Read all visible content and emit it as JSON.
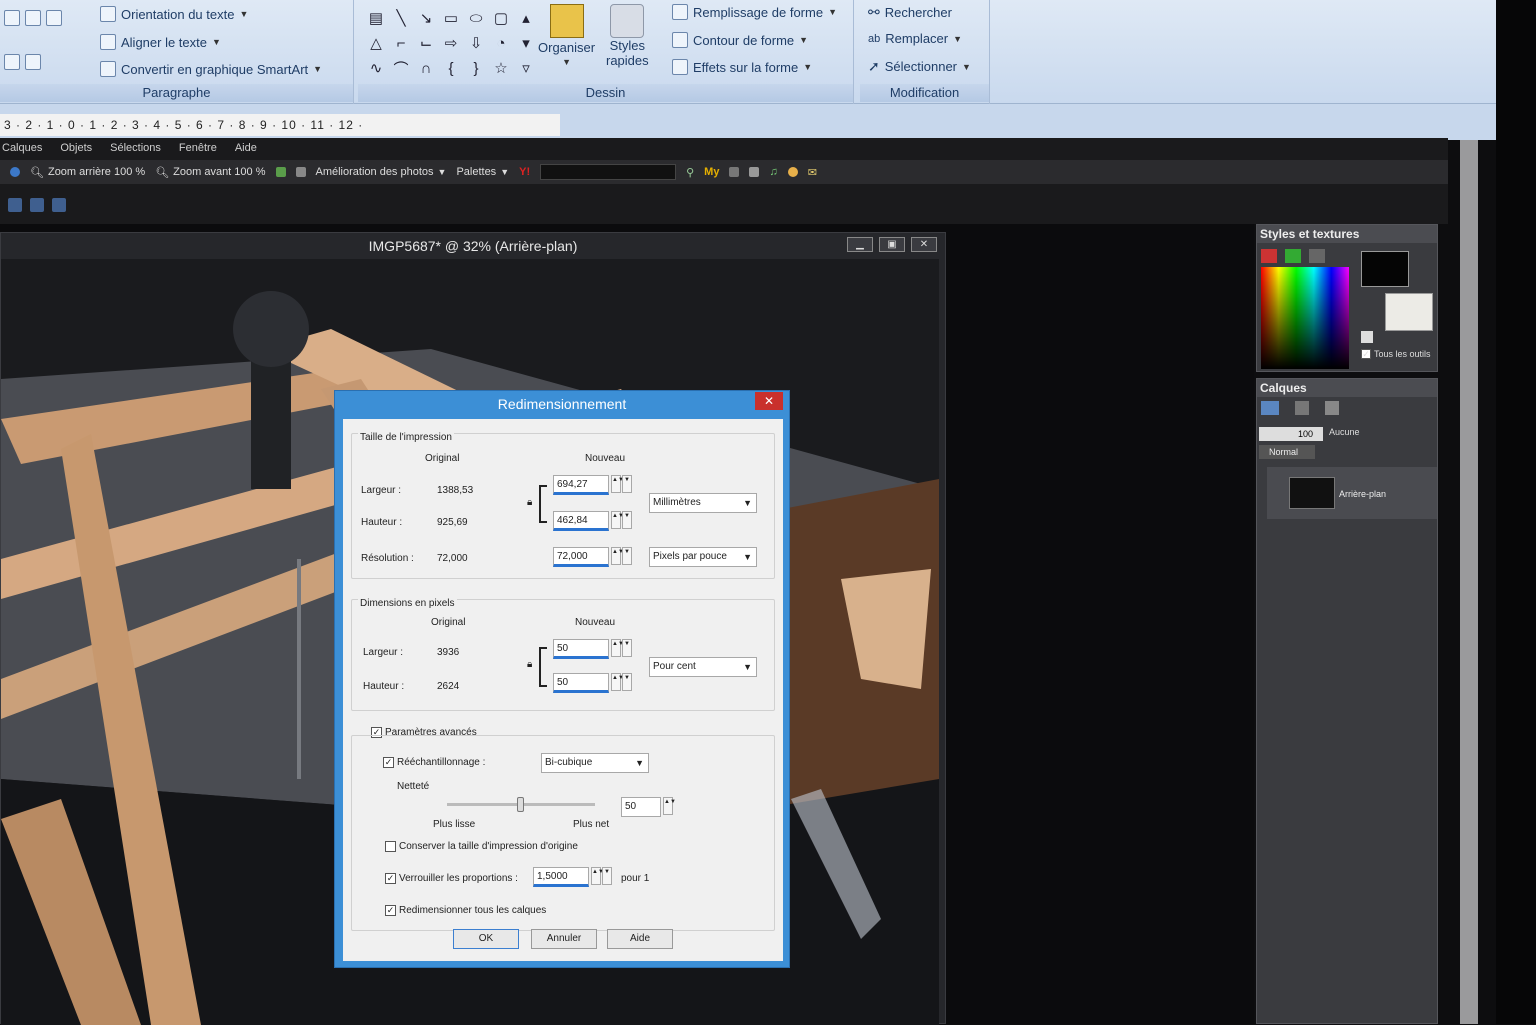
{
  "ribbon": {
    "paragraph_group": {
      "label": "Paragraphe",
      "orientation": "Orientation du texte",
      "align": "Aligner le texte",
      "smartart": "Convertir en graphique SmartArt"
    },
    "drawing_group": {
      "label": "Dessin",
      "organize": "Organiser",
      "quick_styles_1": "Styles",
      "quick_styles_2": "rapides",
      "fill": "Remplissage de forme",
      "outline": "Contour de forme",
      "effects": "Effets sur la forme"
    },
    "modify_group": {
      "label": "Modification",
      "find": "Rechercher",
      "replace": "Remplacer",
      "select": "Sélectionner"
    }
  },
  "ruler": "3 · 2 · 1 · 0 · 1 · 2 · 3 · 4 · 5 · 6 · 7 · 8 · 9 · 10 · 11 · 12 ·",
  "psp": {
    "menu": [
      "Calques",
      "Objets",
      "Sélections",
      "Fenêtre",
      "Aide"
    ],
    "toolbar": {
      "zoom_out": "Zoom arrière 100 %",
      "zoom_in": "Zoom avant 100 %",
      "photo_enhance": "Amélioration des photos",
      "palettes": "Palettes",
      "my": "My"
    },
    "image_window_title": "IMGP5687* @  32% (Arrière-plan)",
    "styles_panel": {
      "title": "Styles et textures",
      "all_tools": "Tous les outils"
    },
    "layers_panel": {
      "title": "Calques",
      "opacity": "100",
      "mask": "Aucune",
      "blend": "Normal",
      "layer_name": "Arrière-plan"
    }
  },
  "dialog": {
    "title": "Redimensionnement",
    "close": "✕",
    "print_size": {
      "title": "Taille de l'impression",
      "col_original": "Original",
      "col_new": "Nouveau",
      "width_label": "Largeur :",
      "width_orig": "1388,53",
      "width_new": "694,27",
      "height_label": "Hauteur :",
      "height_orig": "925,69",
      "height_new": "462,84",
      "unit": "Millimètres",
      "res_label": "Résolution :",
      "res_orig": "72,000",
      "res_new": "72,000",
      "res_unit": "Pixels par pouce"
    },
    "pixel_dims": {
      "title": "Dimensions en pixels",
      "col_original": "Original",
      "col_new": "Nouveau",
      "width_label": "Largeur :",
      "width_orig": "3936",
      "width_new": "50",
      "height_label": "Hauteur :",
      "height_orig": "2624",
      "height_new": "50",
      "unit": "Pour cent"
    },
    "advanced": "Paramètres avancés",
    "resample": "Rééchantillonnage :",
    "resample_method": "Bi-cubique",
    "sharpness": "Netteté",
    "sharpness_value": "50",
    "sharpness_fraction": 0.5,
    "smoother": "Plus lisse",
    "sharper": "Plus net",
    "keep_print": "Conserver la taille d'impression d'origine",
    "lock_ratio": "Verrouiller les proportions :",
    "ratio_value": "1,5000",
    "ratio_suffix": "pour 1",
    "resize_all": "Redimensionner tous les calques",
    "ok": "OK",
    "cancel": "Annuler",
    "help": "Aide"
  }
}
